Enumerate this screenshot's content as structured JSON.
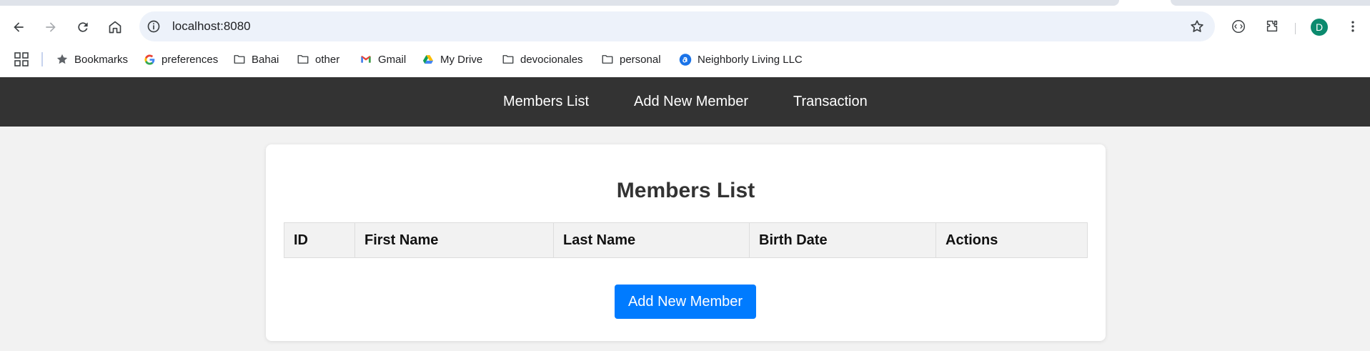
{
  "browser": {
    "url": "localhost:8080",
    "avatar_initial": "D",
    "bookmarks": [
      {
        "label": "Bookmarks",
        "icon": "star-icon"
      },
      {
        "label": "preferences",
        "icon": "google-icon"
      },
      {
        "label": "Bahai",
        "icon": "folder-icon"
      },
      {
        "label": "other",
        "icon": "folder-icon"
      },
      {
        "label": "Gmail",
        "icon": "gmail-icon"
      },
      {
        "label": "My Drive",
        "icon": "drive-icon"
      },
      {
        "label": "devocionales",
        "icon": "folder-icon"
      },
      {
        "label": "personal",
        "icon": "folder-icon"
      },
      {
        "label": "Neighborly Living LLC",
        "icon": "neighborly-icon"
      }
    ]
  },
  "nav": {
    "items": [
      "Members List",
      "Add New Member",
      "Transaction"
    ]
  },
  "page": {
    "title": "Members List",
    "table_headers": [
      "ID",
      "First Name",
      "Last Name",
      "Birth Date",
      "Actions"
    ],
    "add_button_label": "Add New Member"
  },
  "colors": {
    "nav_bg": "#333333",
    "accent": "#007bff",
    "page_bg": "#f2f2f2"
  }
}
